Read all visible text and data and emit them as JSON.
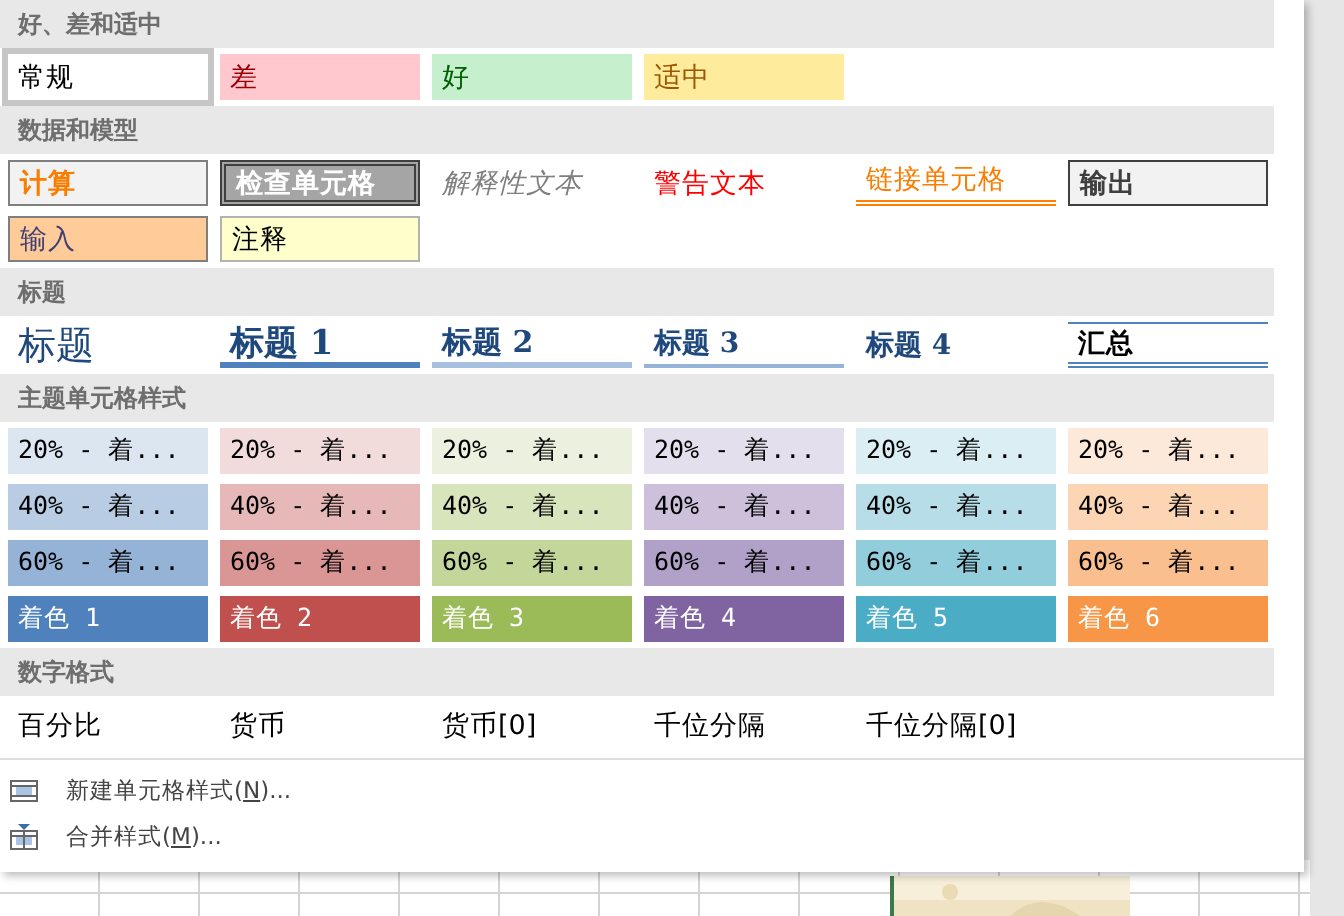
{
  "sections": [
    {
      "title": "好、差和适中",
      "rows": [
        [
          {
            "label": "常规",
            "kind": "normal",
            "selected": true
          },
          {
            "label": "差",
            "kind": "bad",
            "selected": false
          },
          {
            "label": "好",
            "kind": "good",
            "selected": false
          },
          {
            "label": "适中",
            "kind": "neutral",
            "selected": false
          }
        ]
      ]
    },
    {
      "title": "数据和模型",
      "rows": [
        [
          {
            "label": "计算",
            "kind": "calculation",
            "selected": false
          },
          {
            "label": "检查单元格",
            "kind": "check",
            "selected": false
          },
          {
            "label": "解释性文本",
            "kind": "explanatory",
            "selected": false
          },
          {
            "label": "警告文本",
            "kind": "warning",
            "selected": false
          },
          {
            "label": "链接单元格",
            "kind": "linked",
            "selected": false
          },
          {
            "label": "输出",
            "kind": "output",
            "selected": false
          }
        ],
        [
          {
            "label": "输入",
            "kind": "input",
            "selected": false
          },
          {
            "label": "注释",
            "kind": "note",
            "selected": false
          }
        ]
      ]
    },
    {
      "title": "标题",
      "rows": [
        [
          {
            "label": "标题",
            "kind": "title",
            "selected": false
          },
          {
            "label": "标题 1",
            "kind": "heading1",
            "selected": false
          },
          {
            "label": "标题 2",
            "kind": "heading2",
            "selected": false
          },
          {
            "label": "标题 3",
            "kind": "heading3",
            "selected": false
          },
          {
            "label": "标题 4",
            "kind": "heading4",
            "selected": false
          },
          {
            "label": "汇总",
            "kind": "total",
            "selected": false
          }
        ]
      ]
    },
    {
      "title": "主题单元格样式",
      "rows": [
        [
          {
            "label": "20% - 着...",
            "kind": "tint",
            "color": "#dce6f1",
            "selected": false
          },
          {
            "label": "20% - 着...",
            "kind": "tint",
            "color": "#f2dcdb",
            "selected": false
          },
          {
            "label": "20% - 着...",
            "kind": "tint",
            "color": "#ebf1de",
            "selected": false
          },
          {
            "label": "20% - 着...",
            "kind": "tint",
            "color": "#e4dfec",
            "selected": false
          },
          {
            "label": "20% - 着...",
            "kind": "tint",
            "color": "#daeef3",
            "selected": false
          },
          {
            "label": "20% - 着...",
            "kind": "tint",
            "color": "#fde9d9",
            "selected": false
          }
        ],
        [
          {
            "label": "40% - 着...",
            "kind": "tint",
            "color": "#b8cce4",
            "selected": false
          },
          {
            "label": "40% - 着...",
            "kind": "tint",
            "color": "#e6b8b7",
            "selected": false
          },
          {
            "label": "40% - 着...",
            "kind": "tint",
            "color": "#d8e4bc",
            "selected": false
          },
          {
            "label": "40% - 着...",
            "kind": "tint",
            "color": "#ccc0da",
            "selected": false
          },
          {
            "label": "40% - 着...",
            "kind": "tint",
            "color": "#b7dee8",
            "selected": false
          },
          {
            "label": "40% - 着...",
            "kind": "tint",
            "color": "#fcd5b4",
            "selected": false
          }
        ],
        [
          {
            "label": "60% - 着...",
            "kind": "tint",
            "color": "#95b3d7",
            "selected": false
          },
          {
            "label": "60% - 着...",
            "kind": "tint",
            "color": "#da9694",
            "selected": false
          },
          {
            "label": "60% - 着...",
            "kind": "tint",
            "color": "#c4d79b",
            "selected": false
          },
          {
            "label": "60% - 着...",
            "kind": "tint",
            "color": "#b1a0c7",
            "selected": false
          },
          {
            "label": "60% - 着...",
            "kind": "tint",
            "color": "#92cddc",
            "selected": false
          },
          {
            "label": "60% - 着...",
            "kind": "tint",
            "color": "#fabf8f",
            "selected": false
          }
        ],
        [
          {
            "label": "着色 1",
            "kind": "accent",
            "color": "#4f81bd",
            "selected": false
          },
          {
            "label": "着色 2",
            "kind": "accent",
            "color": "#c0504d",
            "selected": false
          },
          {
            "label": "着色 3",
            "kind": "accent",
            "color": "#9bbb59",
            "selected": false
          },
          {
            "label": "着色 4",
            "kind": "accent",
            "color": "#8064a2",
            "selected": false
          },
          {
            "label": "着色 5",
            "kind": "accent",
            "color": "#4bacc6",
            "selected": false
          },
          {
            "label": "着色 6",
            "kind": "accent",
            "color": "#f79646",
            "selected": false
          }
        ]
      ]
    },
    {
      "title": "数字格式",
      "rows": [
        [
          {
            "label": "百分比",
            "kind": "plain",
            "selected": false
          },
          {
            "label": "货币",
            "kind": "plain",
            "selected": false
          },
          {
            "label": "货币[0]",
            "kind": "plain",
            "selected": false
          },
          {
            "label": "千位分隔",
            "kind": "plain",
            "selected": false
          },
          {
            "label": "千位分隔[0]",
            "kind": "plain",
            "selected": false
          }
        ]
      ]
    }
  ],
  "menu": [
    {
      "kind": "new",
      "label_parts": [
        "新建单元格样式(",
        "N",
        ")..."
      ]
    },
    {
      "kind": "merge",
      "label_parts": [
        "合并样式(",
        "M",
        ")..."
      ]
    }
  ]
}
